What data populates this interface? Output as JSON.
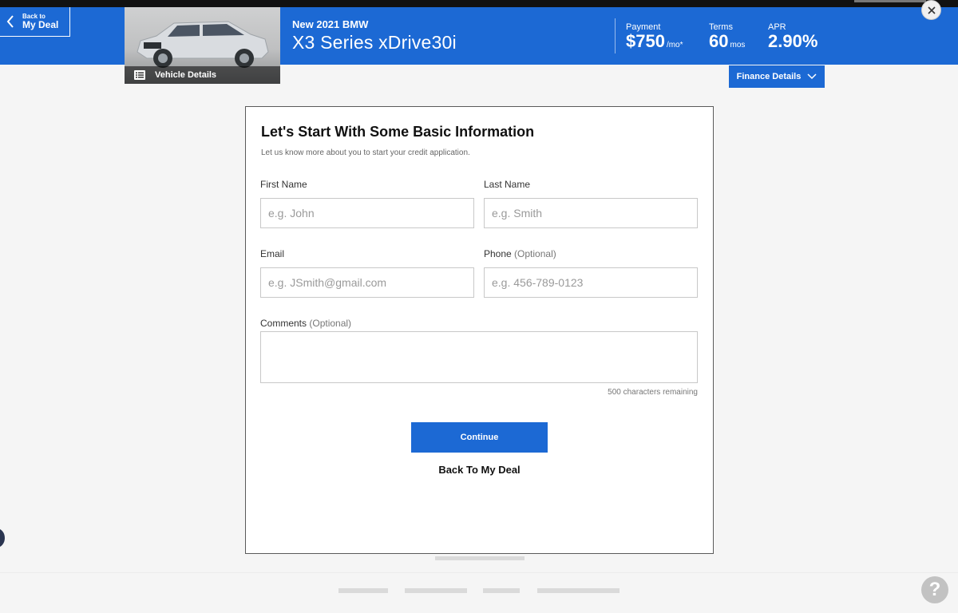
{
  "header": {
    "back_small": "Back to",
    "back_big": "My Deal",
    "vehicle_details_label": "Vehicle Details",
    "model_sub": "New 2021 BMW",
    "model_name": "X3 Series xDrive30i",
    "payment_label": "Payment",
    "payment_value": "$750",
    "payment_unit": "/mo*",
    "terms_label": "Terms",
    "terms_value": "60",
    "terms_unit": "mos",
    "apr_label": "APR",
    "apr_value": "2.90%",
    "finance_details_label": "Finance Details",
    "accent_color": "#1c69d4"
  },
  "modal": {
    "title": "Let's Start With Some Basic Information",
    "subtitle": "Let us know more about you to start your credit application.",
    "first_name_label": "First Name",
    "first_name_placeholder": "e.g. John",
    "last_name_label": "Last Name",
    "last_name_placeholder": "e.g. Smith",
    "email_label": "Email",
    "email_placeholder": "e.g. JSmith@gmail.com",
    "phone_label": "Phone",
    "phone_optional": "(Optional)",
    "phone_placeholder": "e.g. 456-789-0123",
    "comments_label": "Comments",
    "comments_optional": "(Optional)",
    "char_count": "500 characters remaining",
    "continue_label": "Continue",
    "back_link_label": "Back To My Deal"
  },
  "icons": {
    "back": "chevron-left-icon",
    "list": "list-icon",
    "dropdown": "chevron-down-icon",
    "close": "close-icon",
    "help": "question-mark-icon"
  },
  "help_glyph": "?"
}
